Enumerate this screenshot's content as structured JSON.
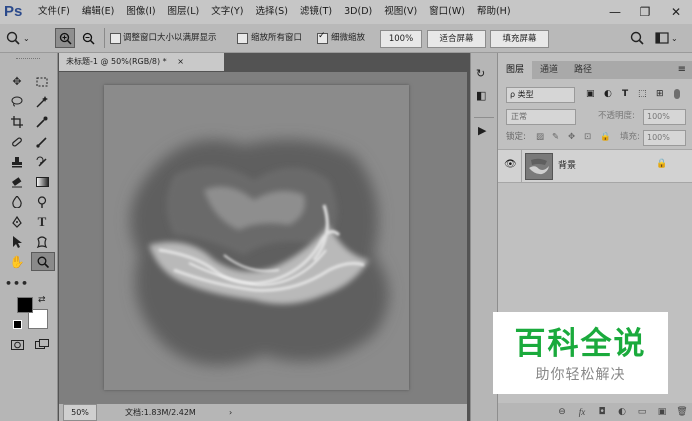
{
  "app": {
    "logo": "Ps",
    "menus": [
      "文件(F)",
      "编辑(E)",
      "图像(I)",
      "图层(L)",
      "文字(Y)",
      "选择(S)",
      "滤镜(T)",
      "3D(D)",
      "视图(V)",
      "窗口(W)",
      "帮助(H)"
    ],
    "window_controls": {
      "minimize": "—",
      "restore": "❐",
      "close": "✕"
    }
  },
  "options": {
    "resize_windows_label": "调整窗口大小以满屏显示",
    "resize_windows_checked": false,
    "zoom_all_label": "缩放所有窗口",
    "zoom_all_checked": false,
    "scrubby_label": "细微缩放",
    "scrubby_checked": true,
    "zoom_value": "100%",
    "fit_screen": "适合屏幕",
    "fill_screen": "填充屏幕"
  },
  "document": {
    "tab_title": "未标题-1 @ 50%(RGB/8) *",
    "tab_close": "×",
    "status_zoom": "50%",
    "status_doc": "文档:1.83M/2.42M",
    "status_arrow": "›"
  },
  "layers_panel": {
    "tabs": [
      "图层",
      "通道",
      "路径"
    ],
    "active_tab": "图层",
    "filter_label": "ρ 类型",
    "blend_mode": "正常",
    "opacity_label": "不透明度:",
    "opacity_value": "100%",
    "lock_label": "锁定:",
    "fill_label": "填充:",
    "fill_value": "100%",
    "layers": [
      {
        "name": "背景",
        "visible": true,
        "locked": true
      }
    ],
    "footer_icons": [
      "link-icon",
      "fx-icon",
      "mask-icon",
      "adjustment-icon",
      "group-icon",
      "new-layer-icon",
      "trash-icon"
    ],
    "footer_glyphs": [
      "⊖",
      "fx",
      "◘",
      "◐",
      "▭",
      "▣",
      "🗑"
    ]
  },
  "watermark": {
    "title": "百科全说",
    "subtitle": "助你轻松解决",
    "color": "#1aaa3c"
  },
  "colors": {
    "foreground": "#000000",
    "background": "#ffffff"
  }
}
